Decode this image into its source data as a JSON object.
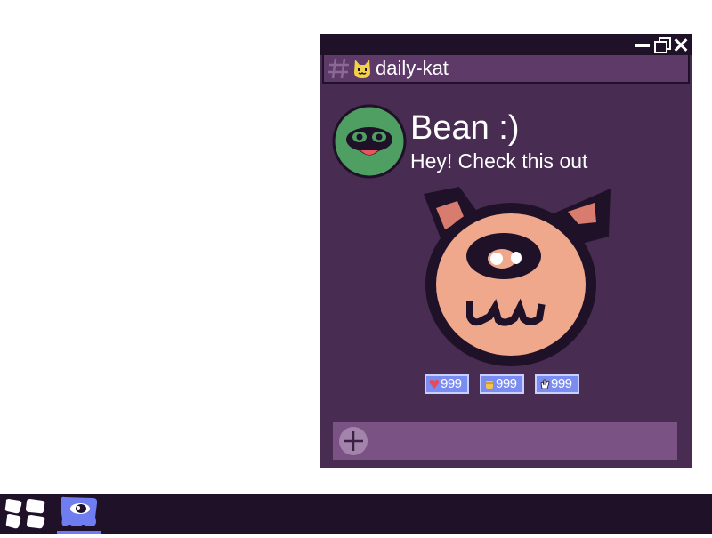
{
  "window": {
    "channel": "daily-kat"
  },
  "message": {
    "author": "Bean :)",
    "text": "Hey! Check this out"
  },
  "reactions": [
    {
      "icon": "heart-icon",
      "count": "999"
    },
    {
      "icon": "fist-icon",
      "count": "999"
    },
    {
      "icon": "hand-icon",
      "count": "999"
    }
  ],
  "composer": {
    "placeholder": ""
  },
  "colors": {
    "window_bg": "#482c52",
    "titlebar_bg": "#1f1128",
    "composer_bg": "#7a5283",
    "reaction_bg": "#7a8cf2",
    "taskbar_accent": "#6f7df0"
  }
}
